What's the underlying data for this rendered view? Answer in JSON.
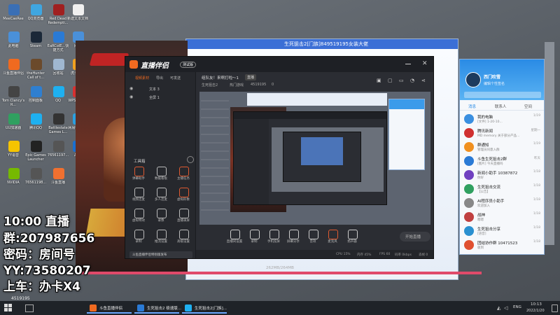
{
  "desktop": {
    "icons": [
      {
        "label": "MeeCaeRee",
        "color": "#3a6fb5"
      },
      {
        "label": "QQ浏览器",
        "color": "#3fa6e0"
      },
      {
        "label": "Red Dead Redempti...",
        "color": "#a02020"
      },
      {
        "label": "新建文本文档",
        "color": "#f0f0f0"
      },
      {
        "label": "此电脑",
        "color": "#4a90d9"
      },
      {
        "label": "Steam",
        "color": "#1b2838"
      },
      {
        "label": "EaRCoIE...快捷方式",
        "color": "#2a7ad5"
      },
      {
        "label": "网络",
        "color": "#4a90d9"
      },
      {
        "label": "斗鱼直播伴侣",
        "color": "#f06a20"
      },
      {
        "label": "theHunter Call of t...",
        "color": "#6b4a2b"
      },
      {
        "label": "回收站",
        "color": "#9fb7d0"
      },
      {
        "label": "虎牙直播",
        "color": "#f0a020"
      },
      {
        "label": "Tom Clancy's R...",
        "color": "#444"
      },
      {
        "label": "控制面板",
        "color": "#2f7fd0"
      },
      {
        "label": "QQ",
        "color": "#1eb0f0"
      },
      {
        "label": "WPS Office",
        "color": "#d83030"
      },
      {
        "label": "UU加速器",
        "color": "#30a060"
      },
      {
        "label": "腾讯QQ",
        "color": "#1eb0f0"
      },
      {
        "label": "Battlestate Games L...",
        "color": "#333"
      },
      {
        "label": "网易UU加速",
        "color": "#2aa0e0"
      },
      {
        "label": "YY语音",
        "color": "#f5c400"
      },
      {
        "label": "Epic Games Launcher",
        "color": "#222"
      },
      {
        "label": "76561197...",
        "color": "#555"
      },
      {
        "label": "战网",
        "color": "#1a6fd0"
      },
      {
        "label": "NVIDIA",
        "color": "#76b900"
      },
      {
        "label": "76561198...",
        "color": "#555"
      },
      {
        "label": "斗鱼直播",
        "color": "#f07030"
      }
    ]
  },
  "back_window": {
    "title": "生死狙击2[门族]849519195女装大佬",
    "scrollbar_info": "262MB/264MB"
  },
  "app": {
    "title": "直播伴侣",
    "version_badge": "测试版",
    "left_menu": [
      "视频素材",
      "导出",
      "可发送"
    ],
    "sources": [
      {
        "name": "文本 3",
        "visible": true
      },
      {
        "name": "全屏 1",
        "visible": true
      }
    ],
    "toolbox_label": "工具箱",
    "tools": [
      "弹幕助手",
      "数据看板",
      "主播任务",
      "视频连麦",
      "多人连麦",
      "虚拟形象",
      "虚拟特效",
      "录像",
      "直播录屏",
      "录制",
      "推流设置",
      "高级设置"
    ],
    "ad_text": "斗鱼直播伴侣特别版发布",
    "header": {
      "room_title": "组队友！来啊打啦～1",
      "room_tag": "直播",
      "category_prefix": "生死狙击2",
      "category": "热门游戏",
      "room_id": "4519195",
      "viewers": "0"
    },
    "bottom_tools": [
      "直播间设置",
      "录制",
      "手机投屏",
      "屏幕分享",
      "音效",
      "麦克风",
      "扬声器"
    ],
    "start_button": "开始直播",
    "status": {
      "cpu": "CPU 15%",
      "mem": "内存 45%",
      "fps": "FPS 60",
      "bitrate": "码率 0kbps",
      "drop": "丢帧 0"
    }
  },
  "qq": {
    "user_name": "西门吹雪",
    "signature": "编辑个性签名",
    "tabs": [
      "消息",
      "联系人",
      "空间"
    ],
    "chats": [
      {
        "name": "我的电脑",
        "preview": "[文件] 1-20-10...",
        "time": "1/19",
        "color": "#3a8fe0"
      },
      {
        "name": "腾讯新闻",
        "preview": "MD memory 关于部分产品...",
        "time": "星期一",
        "color": "#d03030"
      },
      {
        "name": "群通知",
        "preview": "管理员同意入群",
        "time": "1/19",
        "color": "#f09020"
      },
      {
        "name": "斗鱼生死狙击2群",
        "preview": "[图片] 今天直播吗",
        "time": "昨天",
        "color": "#2a7ad5"
      },
      {
        "name": "新闻小助手 10387872",
        "preview": "你好",
        "time": "1/18",
        "color": "#7040c0"
      },
      {
        "name": "生死狙击交流",
        "preview": "【公告】",
        "time": "1/18",
        "color": "#30a060"
      },
      {
        "name": "AI程序员小助手",
        "preview": "欢迎加入",
        "time": "1/18",
        "color": "#888"
      },
      {
        "name": "战神",
        "preview": "嗯嗯",
        "time": "1/18",
        "color": "#c04040"
      },
      {
        "name": "生死狙击分享",
        "preview": "[语音]",
        "time": "1/18",
        "color": "#2a90d0"
      },
      {
        "name": "团结协作群 10471523",
        "preview": "收到",
        "time": "1/18",
        "color": "#e05030"
      }
    ]
  },
  "overlay": {
    "line1": "10:00 直播",
    "line2": "群:207987656",
    "line3": "密码：房间号",
    "line4": "YY:73580207",
    "line5": "上车：办卡X4",
    "room_small": "4519195"
  },
  "taskbar": {
    "buttons": [
      {
        "label": "斗鱼直播伴侣",
        "color": "#f06a20"
      },
      {
        "label": "生死狙击2 极速版...",
        "color": "#2a7ad5"
      },
      {
        "label": "生死狙击2[门族]...",
        "color": "#1eb0f0"
      }
    ],
    "lang": "ENG",
    "time": "10:13",
    "date": "2022/1/20"
  }
}
